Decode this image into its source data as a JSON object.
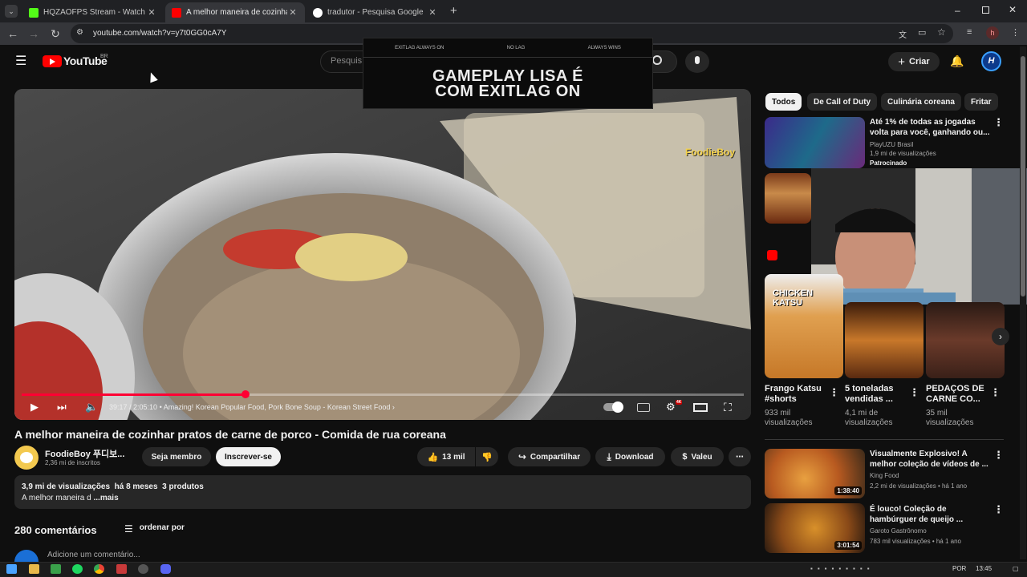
{
  "tabs": [
    {
      "title": "HQZAOFPS Stream - Watch Live",
      "active": false
    },
    {
      "title": "A melhor maneira de cozinhar pratos",
      "active": true
    },
    {
      "title": "tradutor - Pesquisa Google",
      "active": false
    }
  ],
  "address": {
    "url": "youtube.com/watch?v=y7t0GG0cA7Y"
  },
  "profile_initial": "h",
  "youtube": {
    "logo_text": "YouTube",
    "region": "BR",
    "search_placeholder": "Pesquis",
    "create_label": "Criar"
  },
  "overlay": {
    "top_items": [
      "EXITLAG ALWAYS ON",
      "NO LAG",
      "ALWAYS WINS"
    ],
    "headline_line1": "GAMEPLAY LISA É",
    "headline_line2": "COM EXITLAG ON"
  },
  "player": {
    "watermark": "FoodieBoy",
    "time": "39:17 / 2:05:10",
    "chapter": "Amazing! Korean Popular Food, Pork Bone Soup - Korean Street Food",
    "progress_fraction": 0.31,
    "quality_badge": "4K"
  },
  "video": {
    "title": "A melhor maneira de cozinhar pratos de carne de porco - Comida de rua coreana",
    "channel": "FoodieBoy 푸디보...",
    "subscribers": "2,36 mi de inscritos",
    "join_label": "Seja membro",
    "subscribe_label": "Inscrever-se",
    "likes": "13 mil",
    "share_label": "Compartilhar",
    "download_label": "Download",
    "thanks_label": "Valeu",
    "views": "3,9 mi de visualizações",
    "age": "há 8 meses",
    "products": "3 produtos",
    "description": "A melhor maneira d",
    "more_label": "...mais"
  },
  "comments": {
    "count": "280 comentários",
    "sort_label": "ordenar por",
    "add_placeholder": "Adicione um comentário..."
  },
  "chips": [
    "Todos",
    "De Call of Duty",
    "Culinária coreana",
    "Fritar"
  ],
  "sponsored": {
    "title": "Até 1% de todas as jogadas volta para você, ganhando ou...",
    "channel": "PlayUZU Brasil",
    "views": "1,9 mi de visualizações",
    "badge": "Patrocinado"
  },
  "shorts": [
    {
      "thumb_label": "CHICKEN KATSU",
      "title": "Frango Katsu #shorts",
      "views": "933 mil visualizações"
    },
    {
      "thumb_label": "",
      "title": "5 toneladas vendidas ...",
      "views": "4,1 mi de visualizações"
    },
    {
      "thumb_label": "",
      "title": "PEDAÇOS DE CARNE CO...",
      "views": "35 mil visualizações"
    }
  ],
  "related": [
    {
      "title": "Visualmente Explosivo! A melhor coleção de vídeos de ...",
      "channel": "King Food",
      "views": "2,2 mi de visualizações",
      "age": "há 1 ano",
      "duration": "1:38:40"
    },
    {
      "title": "É louco! Coleção de hambúrguer de queijo ...",
      "channel": "Garoto Gastrônomo",
      "views": "783 mil visualizações",
      "age": "há 1 ano",
      "duration": "3:01:54"
    }
  ],
  "taskbar": {
    "language": "POR",
    "time": "13:45"
  },
  "colors": {
    "yt_red": "#ff0000",
    "progress": "#ff0033",
    "background": "#0f0f0f",
    "surface": "#272727"
  }
}
